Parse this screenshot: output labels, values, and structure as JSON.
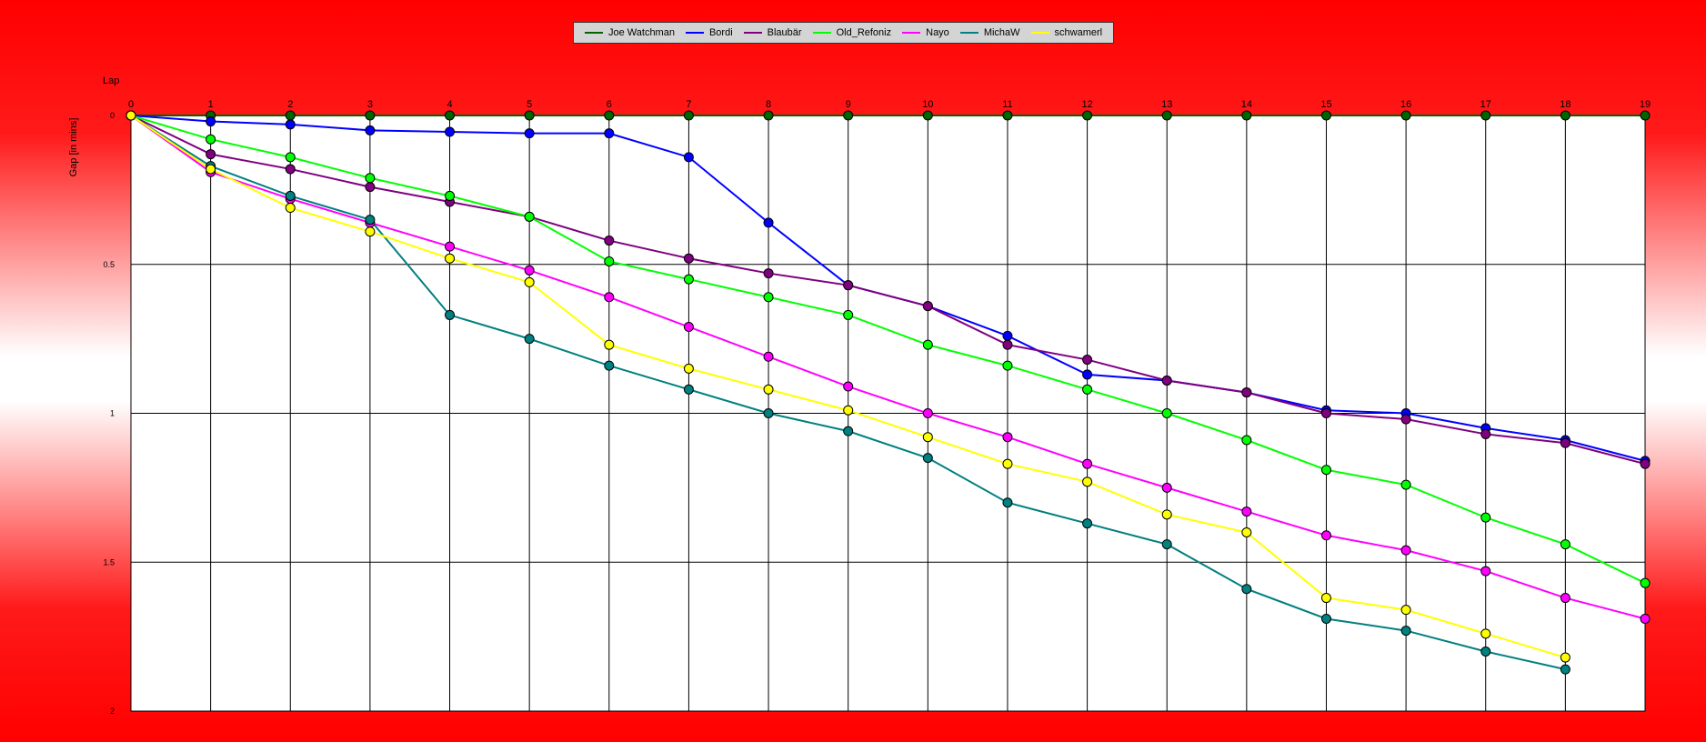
{
  "chart_data": {
    "type": "line",
    "xlabel": "Lap",
    "ylabel": "Gap [in mins]",
    "x_tick_labels": [
      "0",
      "1",
      "2",
      "3",
      "4",
      "5",
      "6",
      "7",
      "8",
      "9",
      "10",
      "11",
      "12",
      "13",
      "14",
      "15",
      "16",
      "17",
      "18",
      "19"
    ],
    "y_tick_labels": [
      "0",
      "0.5",
      "1",
      "1.5",
      "2"
    ],
    "y_ticks": [
      0,
      0.5,
      1,
      1.5,
      2
    ],
    "ylim": [
      0,
      2
    ],
    "y_inverted": true,
    "grid": true,
    "legend_position": "top-center",
    "series": [
      {
        "name": "Joe Watchman",
        "color": "#006400",
        "values": [
          0,
          0,
          0,
          0,
          0,
          0,
          0,
          0,
          0,
          0,
          0,
          0,
          0,
          0,
          0,
          0,
          0,
          0,
          0,
          0
        ]
      },
      {
        "name": "Bordi",
        "color": "#0000ff",
        "values": [
          0,
          0.02,
          0.03,
          0.05,
          0.055,
          0.06,
          0.06,
          0.14,
          0.36,
          0.57,
          0.64,
          0.74,
          0.87,
          0.89,
          0.93,
          0.99,
          1.0,
          1.05,
          1.09,
          1.16
        ]
      },
      {
        "name": "Blaubär",
        "color": "#800080",
        "values": [
          0,
          0.13,
          0.18,
          0.24,
          0.29,
          0.34,
          0.42,
          0.48,
          0.53,
          0.57,
          0.64,
          0.77,
          0.82,
          0.89,
          0.93,
          1.0,
          1.02,
          1.07,
          1.1,
          1.17
        ]
      },
      {
        "name": "Old_Refoniz",
        "color": "#00ff00",
        "values": [
          0,
          0.08,
          0.14,
          0.21,
          0.27,
          0.34,
          0.49,
          0.55,
          0.61,
          0.67,
          0.77,
          0.84,
          0.92,
          1.0,
          1.09,
          1.19,
          1.24,
          1.35,
          1.44,
          1.57
        ]
      },
      {
        "name": "Nayo",
        "color": "#ff00ff",
        "values": [
          0,
          0.19,
          0.28,
          0.36,
          0.44,
          0.52,
          0.61,
          0.71,
          0.81,
          0.91,
          1.0,
          1.08,
          1.17,
          1.25,
          1.33,
          1.41,
          1.46,
          1.53,
          1.62,
          1.69
        ]
      },
      {
        "name": "MichaW",
        "color": "#008080",
        "values": [
          0,
          0.17,
          0.27,
          0.35,
          0.67,
          0.75,
          0.84,
          0.92,
          1.0,
          1.06,
          1.15,
          1.3,
          1.37,
          1.44,
          1.59,
          1.69,
          1.73,
          1.8,
          1.86,
          null
        ]
      },
      {
        "name": "schwamerl",
        "color": "#ffff00",
        "values": [
          0,
          0.18,
          0.31,
          0.39,
          0.48,
          0.56,
          0.77,
          0.85,
          0.92,
          0.99,
          1.08,
          1.17,
          1.23,
          1.34,
          1.4,
          1.62,
          1.66,
          1.74,
          1.82,
          null
        ]
      }
    ]
  }
}
